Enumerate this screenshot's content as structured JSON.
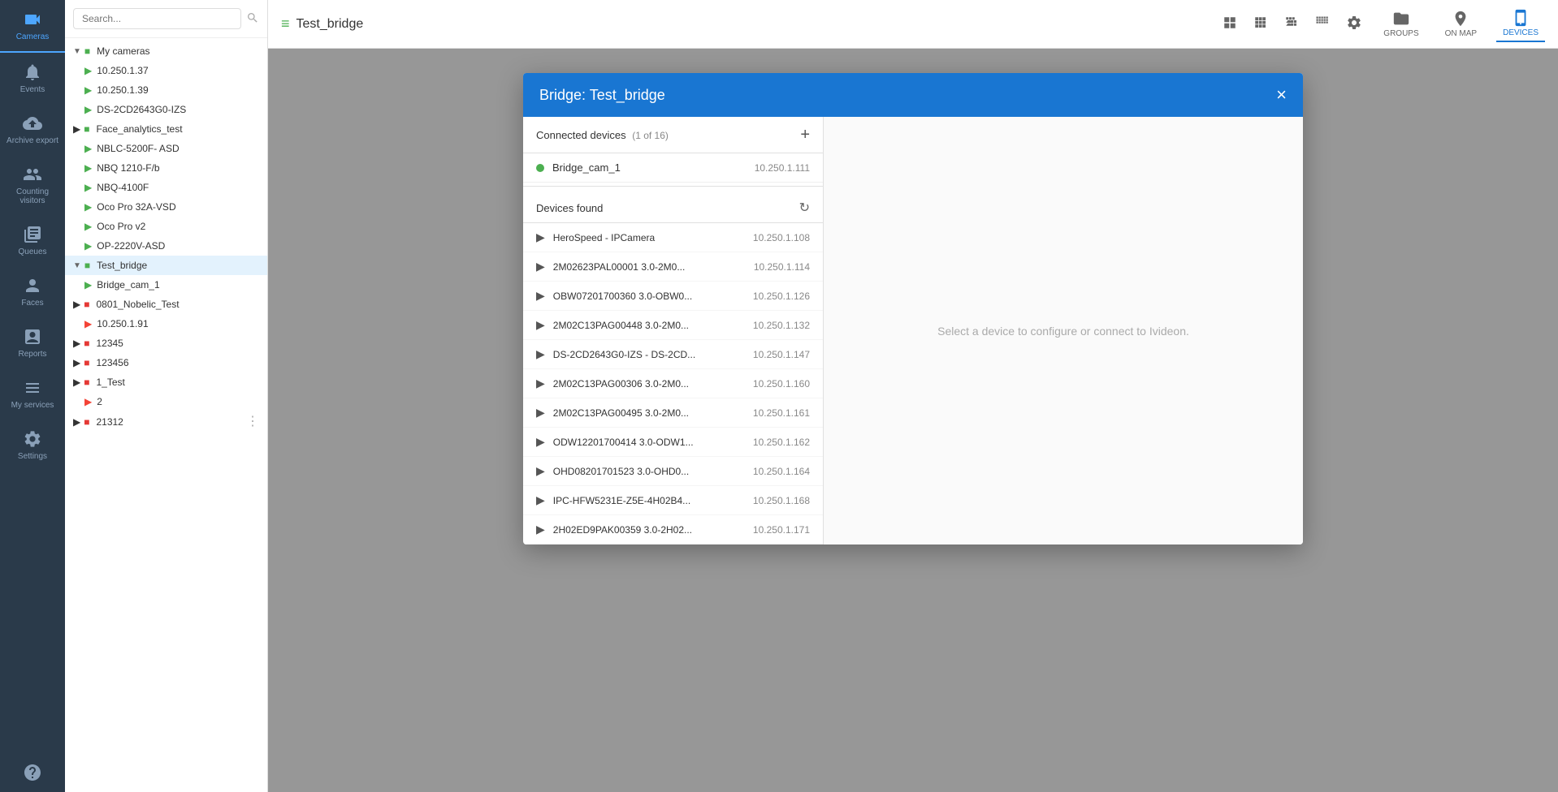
{
  "iconSidebar": {
    "items": [
      {
        "id": "cameras",
        "label": "Cameras",
        "active": true
      },
      {
        "id": "events",
        "label": "Events",
        "active": false
      },
      {
        "id": "archive-export",
        "label": "Archive export",
        "active": false
      },
      {
        "id": "counting-visitors",
        "label": "Counting visitors",
        "active": false
      },
      {
        "id": "queues",
        "label": "Queues",
        "active": false
      },
      {
        "id": "faces",
        "label": "Faces",
        "active": false
      },
      {
        "id": "reports",
        "label": "Reports",
        "active": false
      },
      {
        "id": "my-services",
        "label": "My services",
        "active": false
      },
      {
        "id": "settings",
        "label": "Settings",
        "active": false
      },
      {
        "id": "help",
        "label": "",
        "active": false
      }
    ]
  },
  "search": {
    "placeholder": "Search..."
  },
  "tree": {
    "myCamerasLabel": "My cameras",
    "cameras": [
      {
        "id": "cam1",
        "name": "10.250.1.37",
        "status": "green"
      },
      {
        "id": "cam2",
        "name": "10.250.1.39",
        "status": "green"
      },
      {
        "id": "cam3",
        "name": "DS-2CD2643G0-IZS",
        "status": "green"
      }
    ],
    "faceAnalyticsLabel": "Face_analytics_test",
    "cameraGroup2": [
      {
        "id": "cam4",
        "name": "NBLC-5200F- ASD",
        "status": "green"
      },
      {
        "id": "cam5",
        "name": "NBQ 1210-F/b",
        "status": "green"
      },
      {
        "id": "cam6",
        "name": "NBQ-4100F",
        "status": "green"
      },
      {
        "id": "cam7",
        "name": "Oco Pro 32A-VSD",
        "status": "green"
      },
      {
        "id": "cam8",
        "name": "Oco Pro v2",
        "status": "green"
      },
      {
        "id": "cam9",
        "name": "OP-2220V-ASD",
        "status": "green"
      }
    ],
    "testBridgeLabel": "Test_bridge",
    "bridgeCam": "Bridge_cam_1",
    "otherGroups": [
      {
        "id": "g1",
        "name": "0801_Nobelic_Test",
        "color": "red"
      },
      {
        "id": "g2",
        "name": "10.250.1.91",
        "status": "red"
      },
      {
        "id": "g3",
        "name": "12345",
        "color": "red"
      },
      {
        "id": "g4",
        "name": "123456",
        "color": "red"
      },
      {
        "id": "g5",
        "name": "1_Test",
        "color": "red"
      },
      {
        "id": "g6",
        "name": "2",
        "status": "red"
      },
      {
        "id": "g7",
        "name": "21312",
        "color": "red"
      }
    ]
  },
  "topBar": {
    "titleIcon": "≡",
    "title": "Test_bridge",
    "viewButtons": [
      "grid-lg",
      "grid-md",
      "grid-sm",
      "grid-xs"
    ],
    "settingsLabel": "⚙",
    "navItems": [
      {
        "id": "groups",
        "label": "GROUPS",
        "active": false
      },
      {
        "id": "on-map",
        "label": "ON MAP",
        "active": false
      },
      {
        "id": "devices",
        "label": "DEVICES",
        "active": true
      }
    ]
  },
  "dialog": {
    "title": "Bridge: Test_bridge",
    "connectedDevices": {
      "label": "Connected devices",
      "count": "(1 of 16)",
      "items": [
        {
          "name": "Bridge_cam_1",
          "ip": "10.250.1.111",
          "status": "green"
        }
      ]
    },
    "devicesFound": {
      "label": "Devices found",
      "items": [
        {
          "name": "HeroSpeed - IPCamera",
          "ip": "10.250.1.108"
        },
        {
          "name": "2M02623PAL00001 3.0-2M0...",
          "ip": "10.250.1.114"
        },
        {
          "name": "OBW07201700360 3.0-OBW0...",
          "ip": "10.250.1.126"
        },
        {
          "name": "2M02C13PAG00448 3.0-2M0...",
          "ip": "10.250.1.132"
        },
        {
          "name": "DS-2CD2643G0-IZS - DS-2CD...",
          "ip": "10.250.1.147"
        },
        {
          "name": "2M02C13PAG00306 3.0-2M0...",
          "ip": "10.250.1.160"
        },
        {
          "name": "2M02C13PAG00495 3.0-2M0...",
          "ip": "10.250.1.161"
        },
        {
          "name": "ODW12201700414 3.0-ODW1...",
          "ip": "10.250.1.162"
        },
        {
          "name": "OHD08201701523 3.0-OHD0...",
          "ip": "10.250.1.164"
        },
        {
          "name": "IPC-HFW5231E-Z5E-4H02B4...",
          "ip": "10.250.1.168"
        },
        {
          "name": "2H02ED9PAK00359 3.0-2H02...",
          "ip": "10.250.1.171"
        }
      ]
    },
    "rightPanelText": "Select a device to configure or connect to Ivideon."
  }
}
